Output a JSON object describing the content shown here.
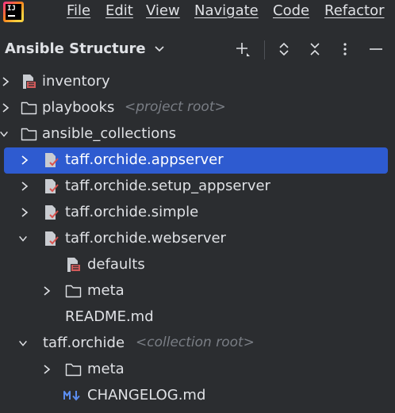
{
  "app": {
    "logo_text": "IJ"
  },
  "menu": [
    "File",
    "Edit",
    "View",
    "Navigate",
    "Code",
    "Refactor"
  ],
  "toolwindow": {
    "title": "Ansible Structure"
  },
  "tree": [
    {
      "label": "inventory",
      "hint": "",
      "icon": "ansible-file-icon",
      "chevron": "right"
    },
    {
      "label": "playbooks",
      "hint": "<project root>",
      "icon": "folder-icon",
      "chevron": "right"
    },
    {
      "label": "ansible_collections",
      "hint": "",
      "icon": "folder-icon",
      "chevron": "down"
    },
    {
      "label": "taff.orchide.appserver",
      "hint": "",
      "icon": "ansible-collection-icon",
      "chevron": "right",
      "selected": true
    },
    {
      "label": "taff.orchide.setup_appserver",
      "hint": "",
      "icon": "ansible-collection-icon",
      "chevron": "right"
    },
    {
      "label": "taff.orchide.simple",
      "hint": "",
      "icon": "ansible-collection-icon",
      "chevron": "right"
    },
    {
      "label": "taff.orchide.webserver",
      "hint": "",
      "icon": "ansible-collection-icon",
      "chevron": "down"
    },
    {
      "label": "defaults",
      "hint": "",
      "icon": "ansible-file-icon",
      "chevron": ""
    },
    {
      "label": "meta",
      "hint": "",
      "icon": "folder-icon",
      "chevron": "right"
    },
    {
      "label": "README.md",
      "hint": "",
      "icon": "",
      "chevron": ""
    },
    {
      "label": "taff.orchide",
      "hint": "<collection root>",
      "icon": "",
      "chevron": "down"
    },
    {
      "label": "meta",
      "hint": "",
      "icon": "folder-icon",
      "chevron": "right"
    },
    {
      "label": "CHANGELOG.md",
      "hint": "",
      "icon": "markdown-icon",
      "chevron": ""
    }
  ],
  "colors": {
    "selection": "#2e5bd0",
    "background": "#2b2d30",
    "text": "#dfe1e5",
    "hint": "#7a7e85"
  }
}
